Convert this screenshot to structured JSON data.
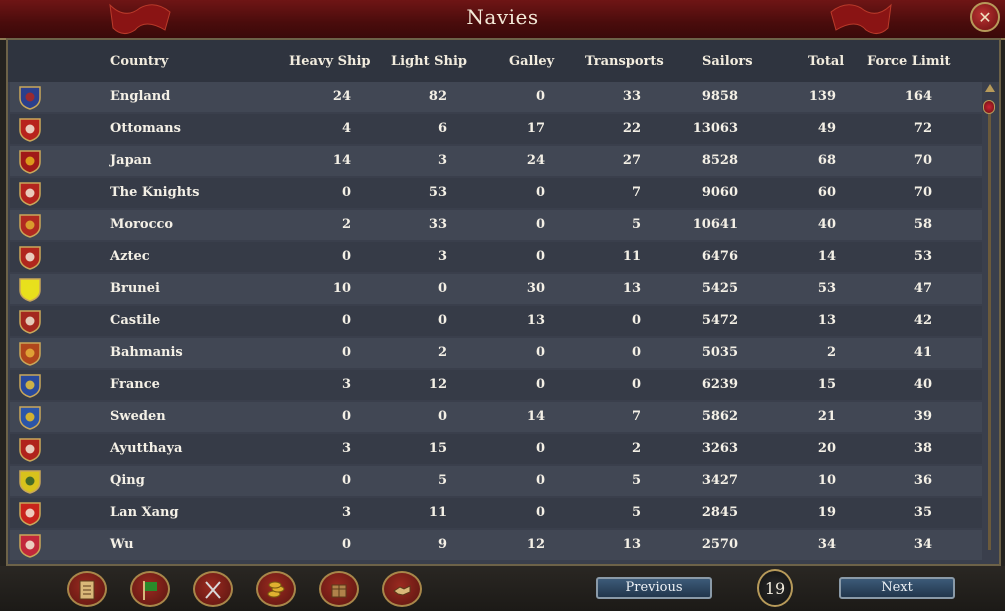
{
  "window": {
    "title": "Navies"
  },
  "columns": {
    "country": "Country",
    "heavy": "Heavy Ship",
    "light": "Light Ship",
    "galley": "Galley",
    "transports": "Transports",
    "sailors": "Sailors",
    "total": "Total",
    "force_limit": "Force Limit"
  },
  "rows": [
    {
      "country": "England",
      "heavy": "24",
      "light": "82",
      "galley": "0",
      "transports": "33",
      "sailors": "9858",
      "total": "139",
      "force_limit": "164",
      "flag_colors": [
        "#2b3f8c",
        "#b0271f"
      ]
    },
    {
      "country": "Ottomans",
      "heavy": "4",
      "light": "6",
      "galley": "17",
      "transports": "22",
      "sailors": "13063",
      "total": "49",
      "force_limit": "72",
      "flag_colors": [
        "#b8231c",
        "#f3ead8"
      ]
    },
    {
      "country": "Japan",
      "heavy": "14",
      "light": "3",
      "galley": "24",
      "transports": "27",
      "sailors": "8528",
      "total": "68",
      "force_limit": "70",
      "flag_colors": [
        "#a01a18",
        "#e6b21c"
      ]
    },
    {
      "country": "The Knights",
      "heavy": "0",
      "light": "53",
      "galley": "0",
      "transports": "7",
      "sailors": "9060",
      "total": "60",
      "force_limit": "70",
      "flag_colors": [
        "#b4241e",
        "#f3ead8"
      ]
    },
    {
      "country": "Morocco",
      "heavy": "2",
      "light": "33",
      "galley": "0",
      "transports": "5",
      "sailors": "10641",
      "total": "40",
      "force_limit": "58",
      "flag_colors": [
        "#b02a20",
        "#e0b030"
      ]
    },
    {
      "country": "Aztec",
      "heavy": "0",
      "light": "3",
      "galley": "0",
      "transports": "11",
      "sailors": "6476",
      "total": "14",
      "force_limit": "53",
      "flag_colors": [
        "#b0261d",
        "#f3ead8"
      ]
    },
    {
      "country": "Brunei",
      "heavy": "10",
      "light": "0",
      "galley": "30",
      "transports": "13",
      "sailors": "5425",
      "total": "53",
      "force_limit": "47",
      "flag_colors": [
        "#e8e01c",
        "#e8e01c"
      ]
    },
    {
      "country": "Castile",
      "heavy": "0",
      "light": "0",
      "galley": "13",
      "transports": "0",
      "sailors": "5472",
      "total": "13",
      "force_limit": "42",
      "flag_colors": [
        "#a4281e",
        "#f0e6d4"
      ]
    },
    {
      "country": "Bahmanis",
      "heavy": "0",
      "light": "2",
      "galley": "0",
      "transports": "0",
      "sailors": "5035",
      "total": "2",
      "force_limit": "41",
      "flag_colors": [
        "#b0461c",
        "#e7b23a"
      ]
    },
    {
      "country": "France",
      "heavy": "3",
      "light": "12",
      "galley": "0",
      "transports": "0",
      "sailors": "6239",
      "total": "15",
      "force_limit": "40",
      "flag_colors": [
        "#2a4a9c",
        "#e7c23a"
      ]
    },
    {
      "country": "Sweden",
      "heavy": "0",
      "light": "0",
      "galley": "14",
      "transports": "7",
      "sailors": "5862",
      "total": "21",
      "force_limit": "39",
      "flag_colors": [
        "#2b55a8",
        "#f0c21c"
      ]
    },
    {
      "country": "Ayutthaya",
      "heavy": "3",
      "light": "15",
      "galley": "0",
      "transports": "2",
      "sailors": "3263",
      "total": "20",
      "force_limit": "38",
      "flag_colors": [
        "#b0231c",
        "#f3ead8"
      ]
    },
    {
      "country": "Qing",
      "heavy": "0",
      "light": "5",
      "galley": "0",
      "transports": "5",
      "sailors": "3427",
      "total": "10",
      "force_limit": "36",
      "flag_colors": [
        "#d8c21c",
        "#2a5a2a"
      ]
    },
    {
      "country": "Lan Xang",
      "heavy": "3",
      "light": "11",
      "galley": "0",
      "transports": "5",
      "sailors": "2845",
      "total": "19",
      "force_limit": "35",
      "flag_colors": [
        "#c8241c",
        "#f3ead8"
      ]
    },
    {
      "country": "Wu",
      "heavy": "0",
      "light": "9",
      "galley": "12",
      "transports": "13",
      "sailors": "2570",
      "total": "34",
      "force_limit": "34",
      "flag_colors": [
        "#c2283a",
        "#f3ead8"
      ]
    }
  ],
  "bottom": {
    "previous_label": "Previous",
    "next_label": "Next",
    "page": "19",
    "tabs": [
      "ledger-icon",
      "flag-icon",
      "crossed-swords-icon",
      "coins-icon",
      "trade-goods-icon",
      "handshake-icon"
    ]
  },
  "close_icon": "close-icon"
}
